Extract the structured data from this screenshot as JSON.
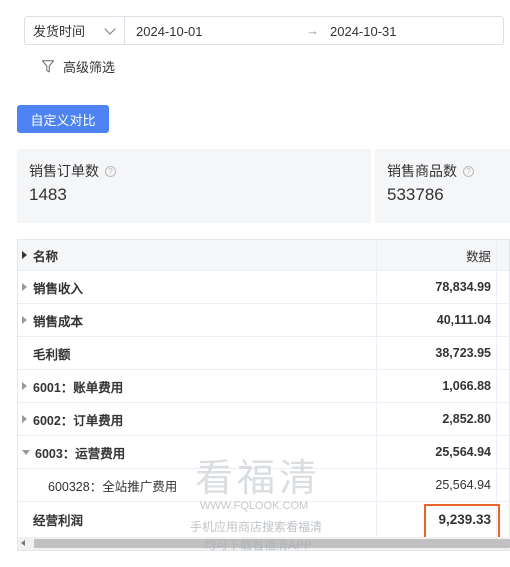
{
  "filter": {
    "field_label": "发货时间",
    "start_date": "2024-10-01",
    "arrow": "→",
    "end_date": "2024-10-31",
    "advanced_label": "高级筛选"
  },
  "custom_compare_label": "自定义对比",
  "stats": [
    {
      "label": "销售订单数",
      "value": "1483"
    },
    {
      "label": "销售商品数",
      "value": "533786"
    }
  ],
  "table": {
    "headers": {
      "name": "名称",
      "data": "数据"
    },
    "rows": [
      {
        "name": "销售收入",
        "value": "78,834.99",
        "expander": "collapsed"
      },
      {
        "name": "销售成本",
        "value": "40,111.04",
        "expander": "collapsed"
      },
      {
        "name": "毛利额",
        "value": "38,723.95",
        "expander": "none"
      },
      {
        "name": "6001：账单费用",
        "value": "1,066.88",
        "expander": "collapsed"
      },
      {
        "name": "6002：订单费用",
        "value": "2,852.80",
        "expander": "collapsed"
      },
      {
        "name": "6003：运营费用",
        "value": "25,564.94",
        "expander": "expanded"
      },
      {
        "name": "600328：全站推广费用",
        "value": "25,564.94",
        "expander": "child"
      },
      {
        "name": "经营利润",
        "value": "9,239.33",
        "expander": "none"
      }
    ]
  },
  "watermark": {
    "title": "看福清",
    "url": "WWW.FQLOOK.COM",
    "line1": "手机应用商店搜索看福清",
    "line2": "均可下载看福清APP"
  },
  "colors": {
    "primary": "#4e83f3",
    "highlight": "#e8642b",
    "card_bg": "#f5f6f8"
  }
}
